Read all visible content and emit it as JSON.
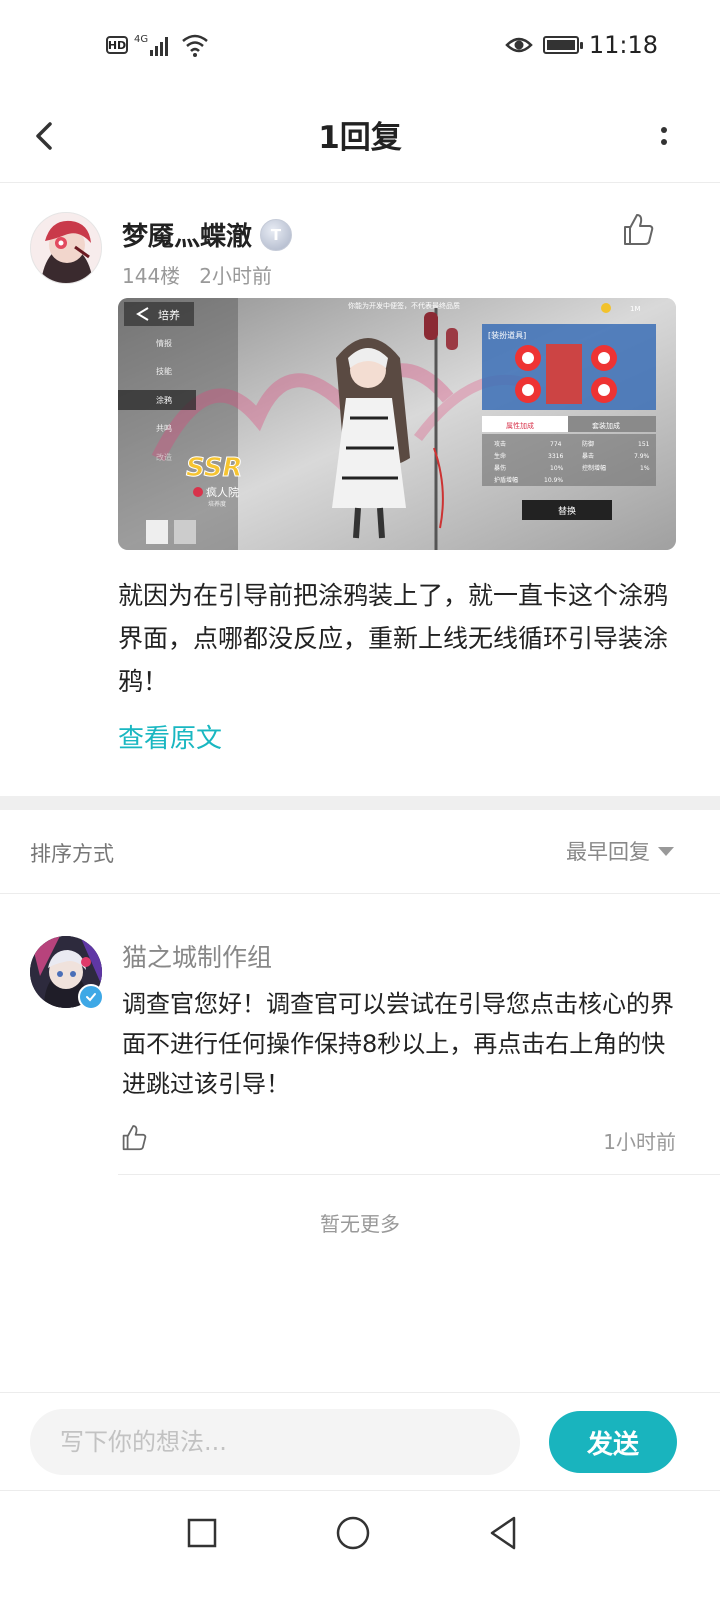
{
  "status_bar": {
    "hd": "HD",
    "network": "4G",
    "time": "11:18"
  },
  "header": {
    "title": "1回复"
  },
  "post": {
    "author": "梦魇灬蝶澈",
    "level": "T",
    "floor": "144楼",
    "time": "2小时前",
    "body": "就因为在引导前把涂鸦装上了，就一直卡这个涂鸦界面，点哪都没反应，重新上线无线循环引导装涂鸦！",
    "view_original": "查看原文",
    "screenshot": {
      "back_label": "培养",
      "top_hint": "你能为开发中便签，不代表最终品质",
      "menu": [
        "情报",
        "技能",
        "涂鸦",
        "共鸣",
        "改造"
      ],
      "rarity": "SSR",
      "character_name": "疯人院",
      "character_sub": "培养度",
      "panel_title": "[装扮道具]",
      "tabs": [
        "属性加成",
        "套装加成"
      ],
      "stats": [
        [
          "攻击",
          "774",
          "防御",
          "151"
        ],
        [
          "生命",
          "3316",
          "暴击",
          "7.9%"
        ],
        [
          "暴伤",
          "10%",
          "控制增幅",
          "1%"
        ],
        [
          "护盾增幅",
          "10.9%",
          "",
          ""
        ]
      ],
      "replace_button": "替换",
      "currency": "1M"
    }
  },
  "sort": {
    "label": "排序方式",
    "selected": "最早回复"
  },
  "reply": {
    "author": "猫之城制作组",
    "body": "调查官您好！调查官可以尝试在引导您点击核心的界面不进行任何操作保持8秒以上，再点击右上角的快进跳过该引导！",
    "time": "1小时前"
  },
  "no_more": "暂无更多",
  "composer": {
    "placeholder": "写下你的想法...",
    "send": "发送"
  },
  "colors": {
    "accent": "#19b4be",
    "link": "#19b7c1",
    "muted": "#999999"
  },
  "icons": {
    "back": "back-arrow-icon",
    "more": "more-vertical-icon",
    "like": "thumbs-up-icon",
    "nav": [
      "square-icon",
      "circle-icon",
      "triangle-back-icon"
    ]
  }
}
